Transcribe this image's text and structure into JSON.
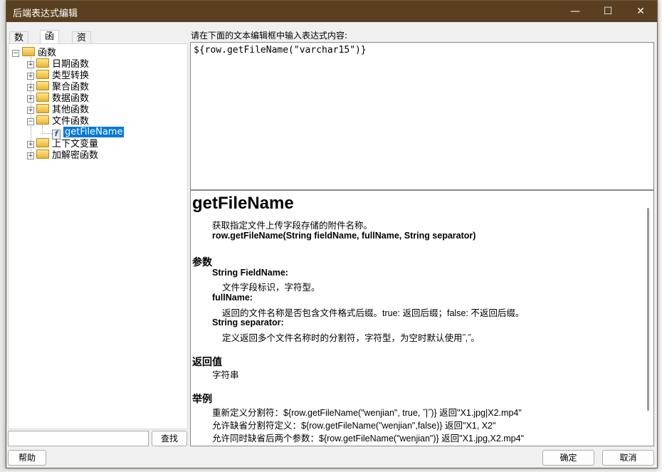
{
  "window": {
    "title": "后端表达式编辑",
    "minimize": "—",
    "maximize": "☐",
    "close": "✕"
  },
  "tabs": [
    {
      "label": "数据"
    },
    {
      "label": "函数"
    },
    {
      "label": "资源"
    }
  ],
  "tree": {
    "root": "函数",
    "items": [
      "日期函数",
      "类型转换",
      "聚合函数",
      "数据函数",
      "其他函数",
      "文件函数",
      "上下文变量",
      "加解密函数"
    ],
    "child": "getFileName"
  },
  "search": {
    "value": "",
    "button": "查找"
  },
  "editor": {
    "label": "请在下面的文本编辑框中输入表达式内容:",
    "value": "${row.getFileName(\"varchar15\")}"
  },
  "doc": {
    "title": "getFileName",
    "desc": "获取指定文件上传字段存储的附件名称。",
    "signature": "row.getFileName(String fieldName,  fullName,  String separator)",
    "params_heading": "参数",
    "params": [
      {
        "name": "String FieldName:",
        "desc": "文件字段标识，字符型。"
      },
      {
        "name": "fullName:",
        "desc": "返回的文件名称是否包含文件格式后缀。true: 返回后缀；false: 不返回后缀。"
      },
      {
        "name": "String separator:",
        "desc": "定义返回多个文件名称时的分割符，字符型，为空时默认使用˝,˝。"
      }
    ],
    "return_heading": "返回值",
    "return": "字符串",
    "example_heading": "举例",
    "examples": [
      "重新定义分割符：${row.getFileName(\"wenjian\", true, ˝|˝)} 返回\"X1.jpg|X2.mp4\"",
      "允许缺省分割符定义：${row.getFileName(\"wenjian\",false)} 返回\"X1, X2\"",
      "允许同时缺省后两个参数：${row.getFileName(\"wenjian\")} 返回\"X1.jpg,X2.mp4\""
    ]
  },
  "buttons": {
    "help": "帮助",
    "ok": "确定",
    "cancel": "取消"
  },
  "accent": "#0078d7",
  "titlebar": "#5a4020"
}
